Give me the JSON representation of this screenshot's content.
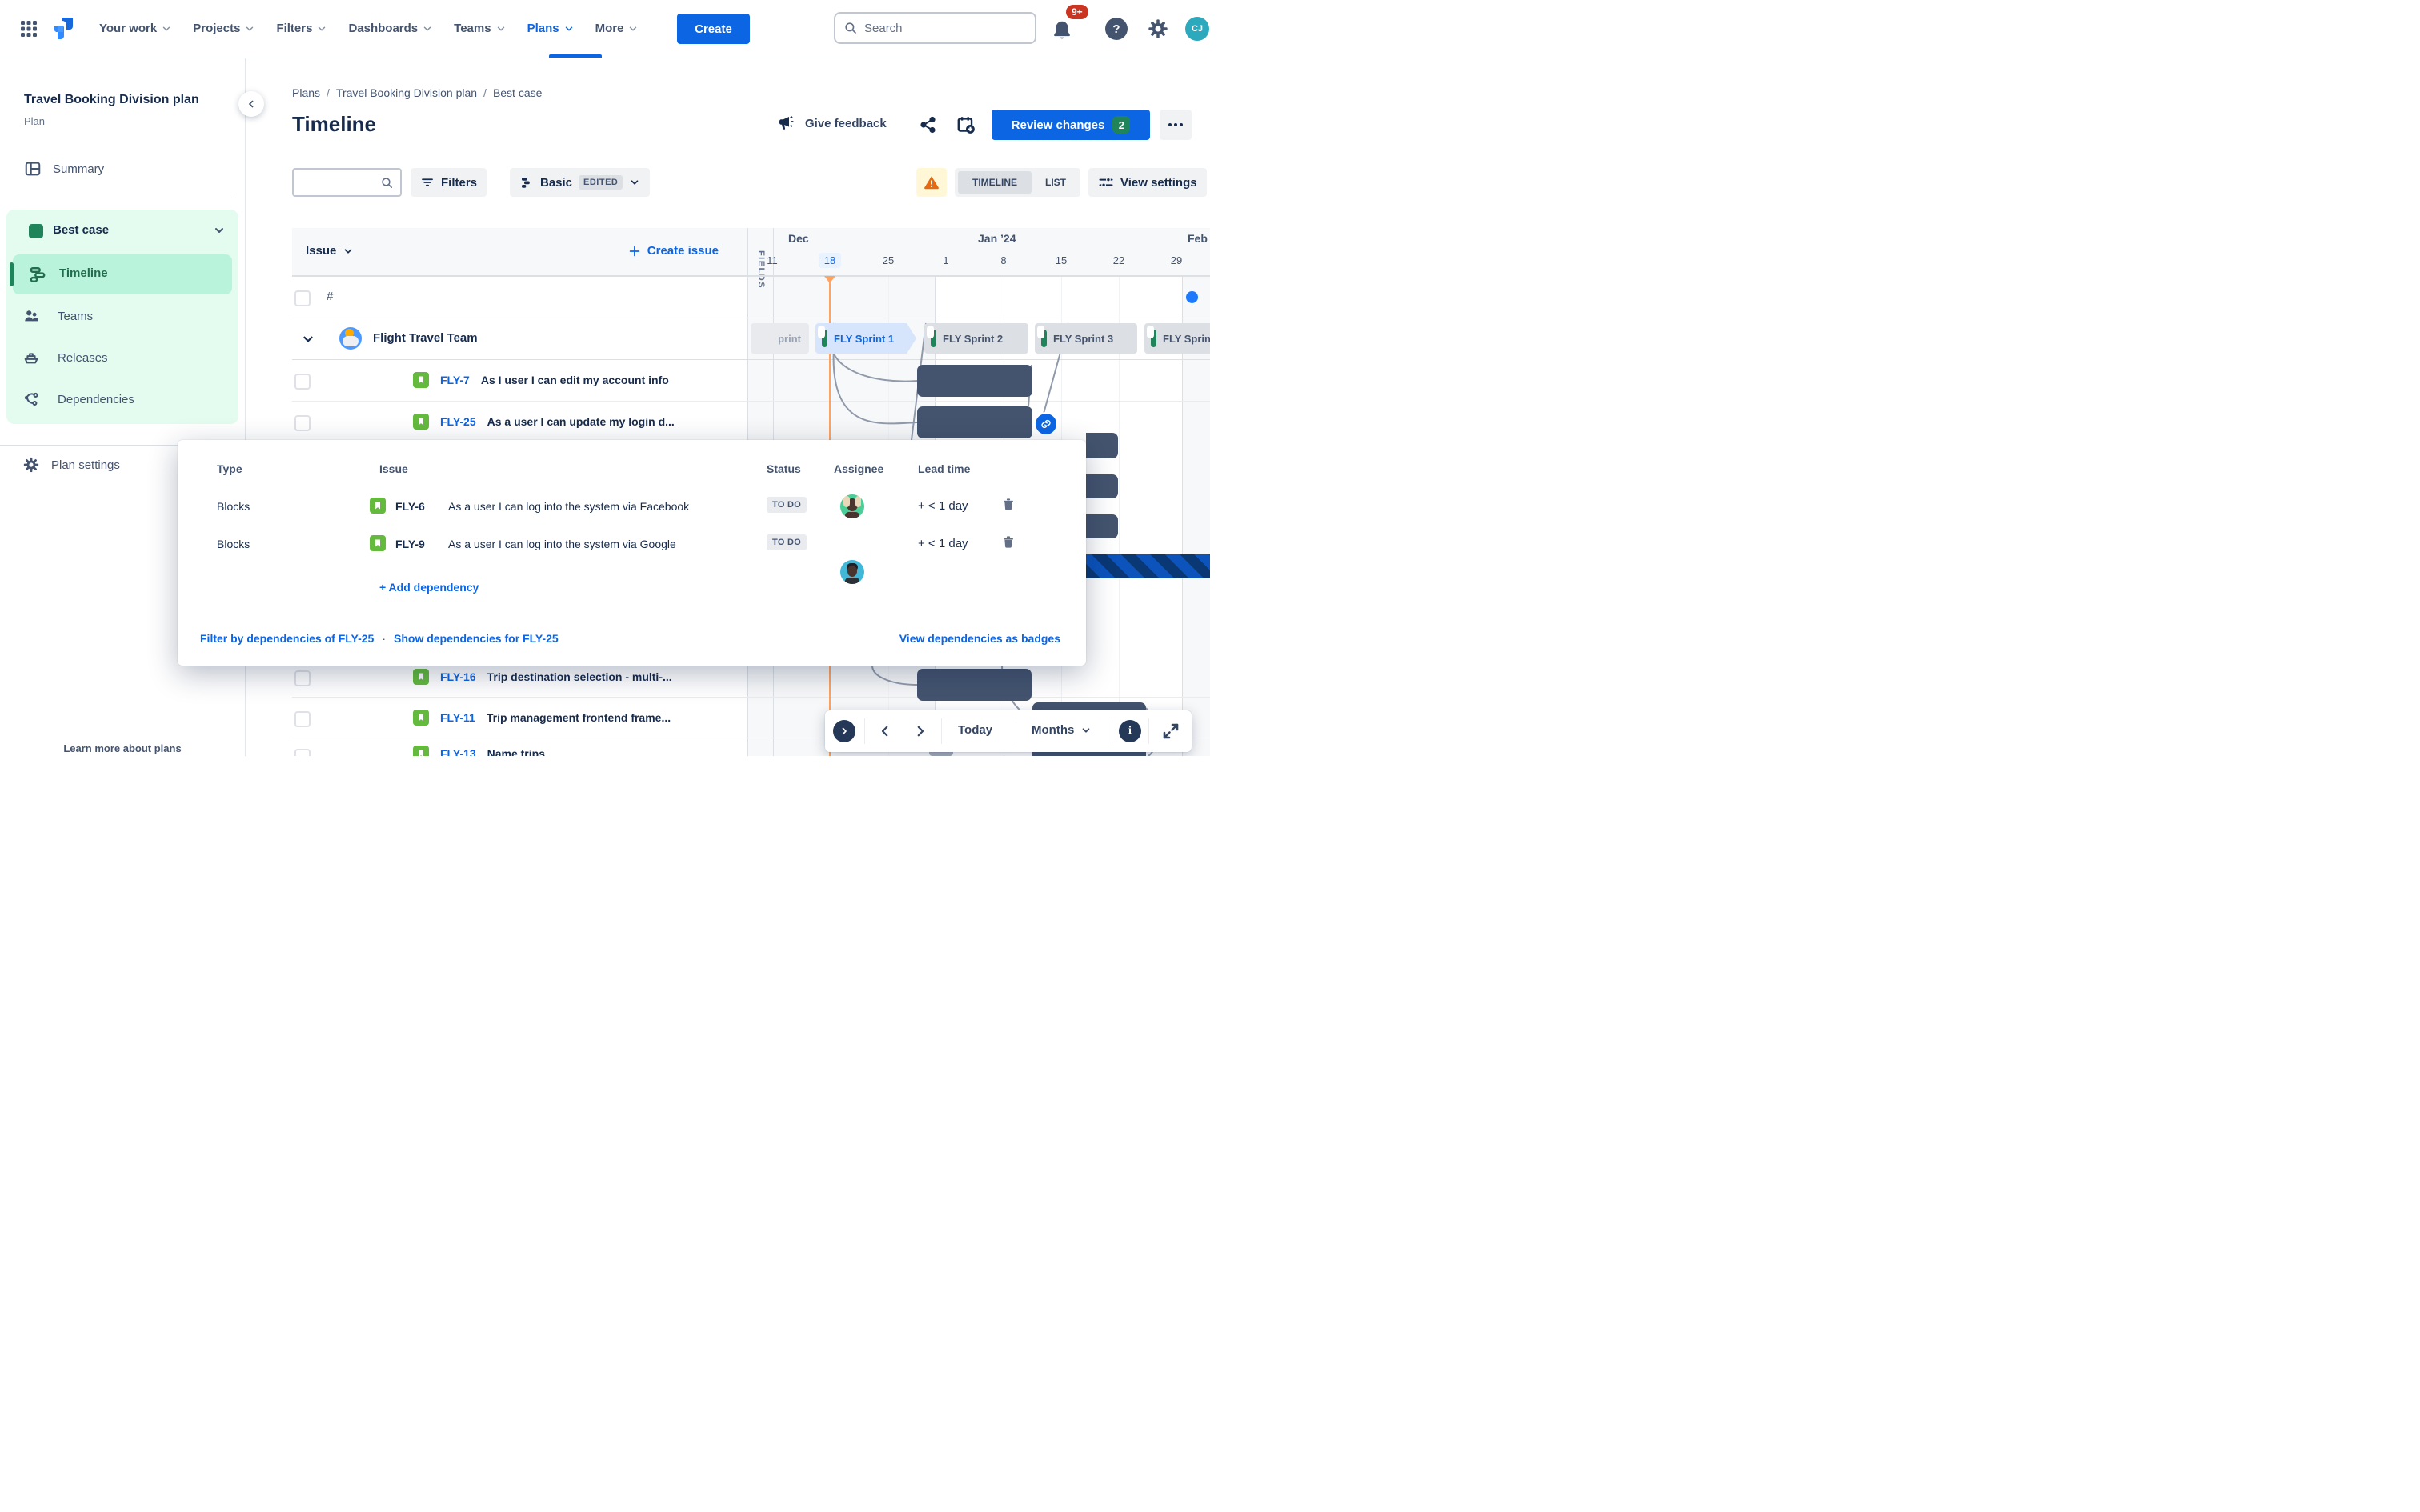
{
  "nav": {
    "items": [
      {
        "label": "Your work"
      },
      {
        "label": "Projects"
      },
      {
        "label": "Filters"
      },
      {
        "label": "Dashboards"
      },
      {
        "label": "Teams"
      },
      {
        "label": "Plans",
        "active": true
      },
      {
        "label": "More"
      }
    ],
    "create_label": "Create",
    "search_placeholder": "Search",
    "notifications_badge": "9+",
    "help_label": "?",
    "avatar_initials": "CJ"
  },
  "sidebar": {
    "title": "Travel Booking Division plan",
    "subtitle": "Plan",
    "summary_label": "Summary",
    "scenario_label": "Best case",
    "items": [
      {
        "label": "Timeline",
        "active": true
      },
      {
        "label": "Teams"
      },
      {
        "label": "Releases"
      },
      {
        "label": "Dependencies"
      }
    ],
    "plan_settings_label": "Plan settings",
    "learn_more_label": "Learn more about plans"
  },
  "header": {
    "breadcrumb": [
      "Plans",
      "Travel Booking Division plan",
      "Best case"
    ],
    "breadcrumb_separator": "/",
    "title": "Timeline",
    "give_feedback_label": "Give feedback",
    "review_changes_label": "Review changes",
    "review_changes_count": "2"
  },
  "toolbar": {
    "filters_label": "Filters",
    "view_mode_label": "Basic",
    "view_mode_badge": "EDITED",
    "timeline_label": "TIMELINE",
    "list_label": "LIST",
    "view_settings_label": "View settings"
  },
  "table": {
    "issue_header_label": "Issue",
    "create_issue_label": "Create issue",
    "fields_label": "FIELDS",
    "hash_label": "#",
    "team_name": "Flight Travel Team",
    "issues": [
      {
        "key": "FLY-7",
        "summary": "As I user I can edit my account info"
      },
      {
        "key": "FLY-25",
        "summary": "As a user I can update my login d..."
      },
      {
        "key": "FLY-16",
        "summary": "Trip destination selection - multi-..."
      },
      {
        "key": "FLY-11",
        "summary": "Trip management frontend frame..."
      },
      {
        "key": "FLY-13",
        "summary": "Name trips"
      }
    ]
  },
  "timeline": {
    "months": [
      "Dec",
      "Jan ’24",
      "Feb"
    ],
    "ticks": [
      "11",
      "18",
      "25",
      "1",
      "8",
      "15",
      "22",
      "29"
    ],
    "today_tick": "18",
    "sprints": [
      {
        "label": "print",
        "state": "closed"
      },
      {
        "label": "FLY Sprint 1",
        "state": "active"
      },
      {
        "label": "FLY Sprint 2",
        "state": "future"
      },
      {
        "label": "FLY Sprint 3",
        "state": "future"
      },
      {
        "label": "FLY Sprin",
        "state": "future"
      }
    ]
  },
  "popup": {
    "columns": {
      "type": "Type",
      "issue": "Issue",
      "status": "Status",
      "assignee": "Assignee",
      "lead_time": "Lead time"
    },
    "rows": [
      {
        "type": "Blocks",
        "key": "FLY-6",
        "summary": "As a user I can log into the system via Facebook",
        "status": "TO DO",
        "lead_time": "+ < 1 day"
      },
      {
        "type": "Blocks",
        "key": "FLY-9",
        "summary": "As a user I can log into the system via Google",
        "status": "TO DO",
        "lead_time": "+ < 1 day"
      }
    ],
    "add_label": "+ Add dependency",
    "filter_link": "Filter by dependencies of FLY-25",
    "link_separator": "·",
    "show_link": "Show dependencies for FLY-25",
    "badges_link": "View dependencies as badges"
  },
  "bottom_toolbar": {
    "today_label": "Today",
    "zoom_label": "Months",
    "info_label": "i"
  },
  "colors": {
    "accent_blue": "#0C66E4",
    "green": "#1F845A",
    "mint_bg": "#E3FCEF",
    "mint_selected": "#BAF3DB",
    "slate_bar": "#44546F",
    "today_orange": "#FEA362",
    "warning_orange": "#E56910",
    "warning_bg": "#FFF7D6",
    "notification_red": "#CA3521",
    "avatar_teal": "#2CA9BC",
    "sprint_active_bg": "#D6E4FC",
    "stripe_dark": "#0A3874",
    "stripe_blue": "#0C53BB"
  }
}
